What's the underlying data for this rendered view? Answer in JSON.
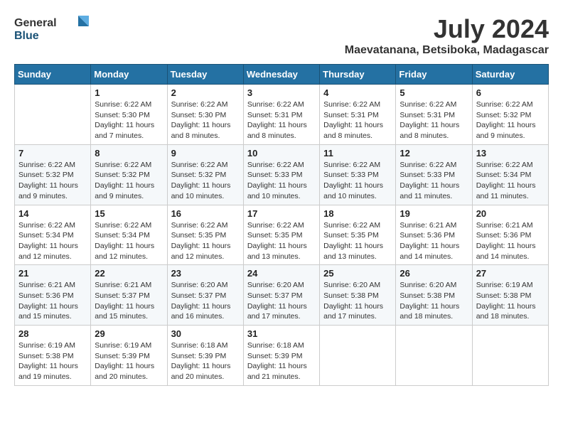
{
  "header": {
    "logo_general": "General",
    "logo_blue": "Blue",
    "month_year": "July 2024",
    "location": "Maevatanana, Betsiboka, Madagascar"
  },
  "weekdays": [
    "Sunday",
    "Monday",
    "Tuesday",
    "Wednesday",
    "Thursday",
    "Friday",
    "Saturday"
  ],
  "weeks": [
    [
      {
        "day": "",
        "sunrise": "",
        "sunset": "",
        "daylight": ""
      },
      {
        "day": "1",
        "sunrise": "Sunrise: 6:22 AM",
        "sunset": "Sunset: 5:30 PM",
        "daylight": "Daylight: 11 hours and 7 minutes."
      },
      {
        "day": "2",
        "sunrise": "Sunrise: 6:22 AM",
        "sunset": "Sunset: 5:30 PM",
        "daylight": "Daylight: 11 hours and 8 minutes."
      },
      {
        "day": "3",
        "sunrise": "Sunrise: 6:22 AM",
        "sunset": "Sunset: 5:31 PM",
        "daylight": "Daylight: 11 hours and 8 minutes."
      },
      {
        "day": "4",
        "sunrise": "Sunrise: 6:22 AM",
        "sunset": "Sunset: 5:31 PM",
        "daylight": "Daylight: 11 hours and 8 minutes."
      },
      {
        "day": "5",
        "sunrise": "Sunrise: 6:22 AM",
        "sunset": "Sunset: 5:31 PM",
        "daylight": "Daylight: 11 hours and 8 minutes."
      },
      {
        "day": "6",
        "sunrise": "Sunrise: 6:22 AM",
        "sunset": "Sunset: 5:32 PM",
        "daylight": "Daylight: 11 hours and 9 minutes."
      }
    ],
    [
      {
        "day": "7",
        "sunrise": "Sunrise: 6:22 AM",
        "sunset": "Sunset: 5:32 PM",
        "daylight": "Daylight: 11 hours and 9 minutes."
      },
      {
        "day": "8",
        "sunrise": "Sunrise: 6:22 AM",
        "sunset": "Sunset: 5:32 PM",
        "daylight": "Daylight: 11 hours and 9 minutes."
      },
      {
        "day": "9",
        "sunrise": "Sunrise: 6:22 AM",
        "sunset": "Sunset: 5:32 PM",
        "daylight": "Daylight: 11 hours and 10 minutes."
      },
      {
        "day": "10",
        "sunrise": "Sunrise: 6:22 AM",
        "sunset": "Sunset: 5:33 PM",
        "daylight": "Daylight: 11 hours and 10 minutes."
      },
      {
        "day": "11",
        "sunrise": "Sunrise: 6:22 AM",
        "sunset": "Sunset: 5:33 PM",
        "daylight": "Daylight: 11 hours and 10 minutes."
      },
      {
        "day": "12",
        "sunrise": "Sunrise: 6:22 AM",
        "sunset": "Sunset: 5:33 PM",
        "daylight": "Daylight: 11 hours and 11 minutes."
      },
      {
        "day": "13",
        "sunrise": "Sunrise: 6:22 AM",
        "sunset": "Sunset: 5:34 PM",
        "daylight": "Daylight: 11 hours and 11 minutes."
      }
    ],
    [
      {
        "day": "14",
        "sunrise": "Sunrise: 6:22 AM",
        "sunset": "Sunset: 5:34 PM",
        "daylight": "Daylight: 11 hours and 12 minutes."
      },
      {
        "day": "15",
        "sunrise": "Sunrise: 6:22 AM",
        "sunset": "Sunset: 5:34 PM",
        "daylight": "Daylight: 11 hours and 12 minutes."
      },
      {
        "day": "16",
        "sunrise": "Sunrise: 6:22 AM",
        "sunset": "Sunset: 5:35 PM",
        "daylight": "Daylight: 11 hours and 12 minutes."
      },
      {
        "day": "17",
        "sunrise": "Sunrise: 6:22 AM",
        "sunset": "Sunset: 5:35 PM",
        "daylight": "Daylight: 11 hours and 13 minutes."
      },
      {
        "day": "18",
        "sunrise": "Sunrise: 6:22 AM",
        "sunset": "Sunset: 5:35 PM",
        "daylight": "Daylight: 11 hours and 13 minutes."
      },
      {
        "day": "19",
        "sunrise": "Sunrise: 6:21 AM",
        "sunset": "Sunset: 5:36 PM",
        "daylight": "Daylight: 11 hours and 14 minutes."
      },
      {
        "day": "20",
        "sunrise": "Sunrise: 6:21 AM",
        "sunset": "Sunset: 5:36 PM",
        "daylight": "Daylight: 11 hours and 14 minutes."
      }
    ],
    [
      {
        "day": "21",
        "sunrise": "Sunrise: 6:21 AM",
        "sunset": "Sunset: 5:36 PM",
        "daylight": "Daylight: 11 hours and 15 minutes."
      },
      {
        "day": "22",
        "sunrise": "Sunrise: 6:21 AM",
        "sunset": "Sunset: 5:37 PM",
        "daylight": "Daylight: 11 hours and 15 minutes."
      },
      {
        "day": "23",
        "sunrise": "Sunrise: 6:20 AM",
        "sunset": "Sunset: 5:37 PM",
        "daylight": "Daylight: 11 hours and 16 minutes."
      },
      {
        "day": "24",
        "sunrise": "Sunrise: 6:20 AM",
        "sunset": "Sunset: 5:37 PM",
        "daylight": "Daylight: 11 hours and 17 minutes."
      },
      {
        "day": "25",
        "sunrise": "Sunrise: 6:20 AM",
        "sunset": "Sunset: 5:38 PM",
        "daylight": "Daylight: 11 hours and 17 minutes."
      },
      {
        "day": "26",
        "sunrise": "Sunrise: 6:20 AM",
        "sunset": "Sunset: 5:38 PM",
        "daylight": "Daylight: 11 hours and 18 minutes."
      },
      {
        "day": "27",
        "sunrise": "Sunrise: 6:19 AM",
        "sunset": "Sunset: 5:38 PM",
        "daylight": "Daylight: 11 hours and 18 minutes."
      }
    ],
    [
      {
        "day": "28",
        "sunrise": "Sunrise: 6:19 AM",
        "sunset": "Sunset: 5:38 PM",
        "daylight": "Daylight: 11 hours and 19 minutes."
      },
      {
        "day": "29",
        "sunrise": "Sunrise: 6:19 AM",
        "sunset": "Sunset: 5:39 PM",
        "daylight": "Daylight: 11 hours and 20 minutes."
      },
      {
        "day": "30",
        "sunrise": "Sunrise: 6:18 AM",
        "sunset": "Sunset: 5:39 PM",
        "daylight": "Daylight: 11 hours and 20 minutes."
      },
      {
        "day": "31",
        "sunrise": "Sunrise: 6:18 AM",
        "sunset": "Sunset: 5:39 PM",
        "daylight": "Daylight: 11 hours and 21 minutes."
      },
      {
        "day": "",
        "sunrise": "",
        "sunset": "",
        "daylight": ""
      },
      {
        "day": "",
        "sunrise": "",
        "sunset": "",
        "daylight": ""
      },
      {
        "day": "",
        "sunrise": "",
        "sunset": "",
        "daylight": ""
      }
    ]
  ]
}
